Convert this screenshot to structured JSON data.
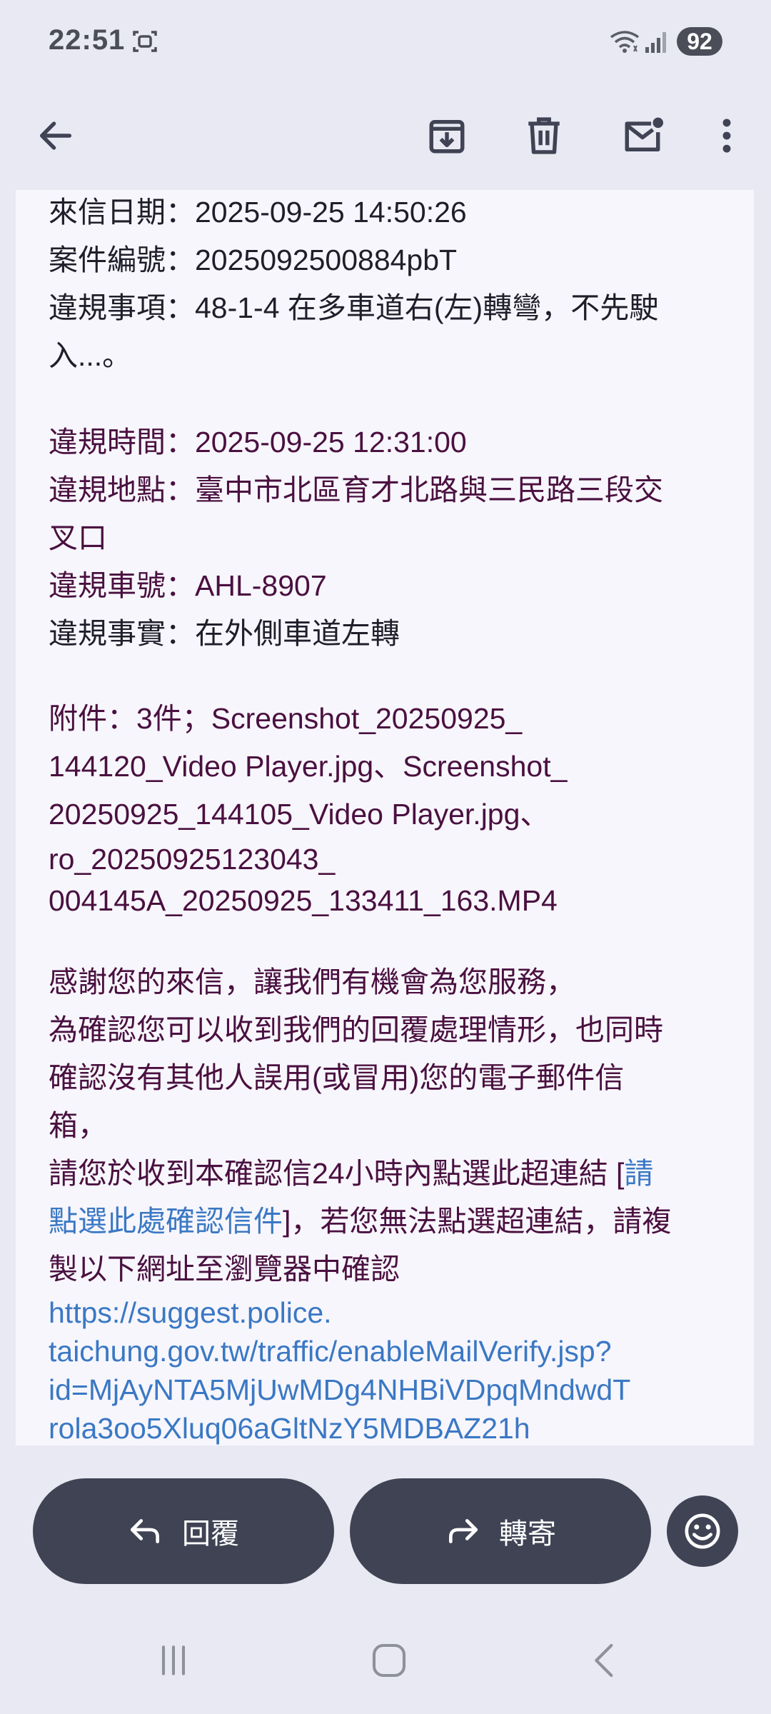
{
  "status_bar": {
    "time": "22:51",
    "battery": "92",
    "icons": [
      "screen-record-icon",
      "wifi-icon",
      "signal-icon",
      "battery-icon"
    ]
  },
  "toolbar": {
    "icons": [
      "back-arrow-icon",
      "archive-icon",
      "trash-icon",
      "mark-unread-icon",
      "more-vertical-icon"
    ]
  },
  "email": {
    "date_line": "來信日期：2025-09-25 14:50:26",
    "case_line": "案件編號：2025092500884pbT",
    "violation_item_line1": "違規事項：48-1-4 在多車道右(左)轉彎，不先駛",
    "violation_item_line2": "入...。",
    "violation_time_line": "違規時間：2025-09-25 12:31:00",
    "violation_place_line1": "違規地點：臺中市北區育才北路與三民路三段交",
    "violation_place_line2": "叉口",
    "plate_line": "違規車號：AHL-8907",
    "fact_line": "違規事實：在外側車道左轉",
    "attach_line1": "附件：3件；Screenshot_20250925_",
    "attach_line2": "144120_Video Player.jpg、Screenshot_",
    "attach_line3": "20250925_144105_Video Player.jpg、",
    "attach_line4": "ro_20250925123043_",
    "attach_line5": "004145A_20250925_133411_163.MP4",
    "thanks_line": "感謝您的來信，讓我們有機會為您服務，",
    "confirm_line1": "為確認您可以收到我們的回覆處理情形，也同時",
    "confirm_line2": "確認沒有其他人誤用(或冒用)您的電子郵件信",
    "confirm_line3": "箱，",
    "click_prefix": "請您於收到本確認信24小時內點選此超連結 [",
    "click_link_part1": "請",
    "click_link_part2": "點選此處確認信件",
    "click_suffix": "]，若您無法點選超連結，請複",
    "copy_line": "製以下網址至瀏覽器中確認",
    "url_line1": "https://suggest.police.",
    "url_line2": "taichung.gov.tw/traffic/enableMailVerify.jsp?",
    "url_line3": "id=MjAyNTA5MjUwMDg4NHBiVDpqMndwdT",
    "url_line4": "rola3oo5Xluq06aGltNzY5MDBAZ21h"
  },
  "actions": {
    "reply_label": "回覆",
    "forward_label": "轉寄"
  },
  "colors": {
    "background": "#e8e9f2",
    "body": "#f7f6fc",
    "pill": "#3f4354",
    "text_purple": "#4a1040",
    "link": "#3a78c4"
  }
}
